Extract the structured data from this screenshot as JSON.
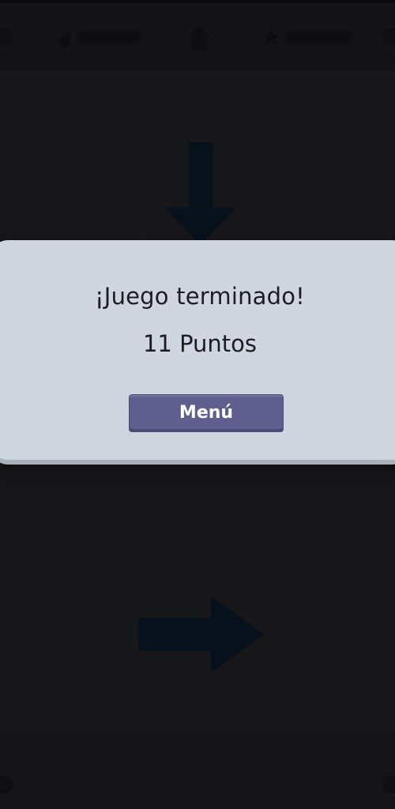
{
  "modal": {
    "title": "¡Juego terminado!",
    "score": "11 Puntos",
    "menu_label": "Menú"
  },
  "icons": {
    "top_left": "circle-icon",
    "stat_left": "fire-icon",
    "home": "home-icon",
    "stat_right": "star-icon",
    "top_right": "circle-icon",
    "arrow_top": "arrow-down-icon",
    "arrow_bottom": "arrow-right-icon"
  },
  "colors": {
    "modal_bg": "#cfd6df",
    "button_bg": "#5f5f8f",
    "arrow": "#07111b",
    "background": "#171719"
  }
}
